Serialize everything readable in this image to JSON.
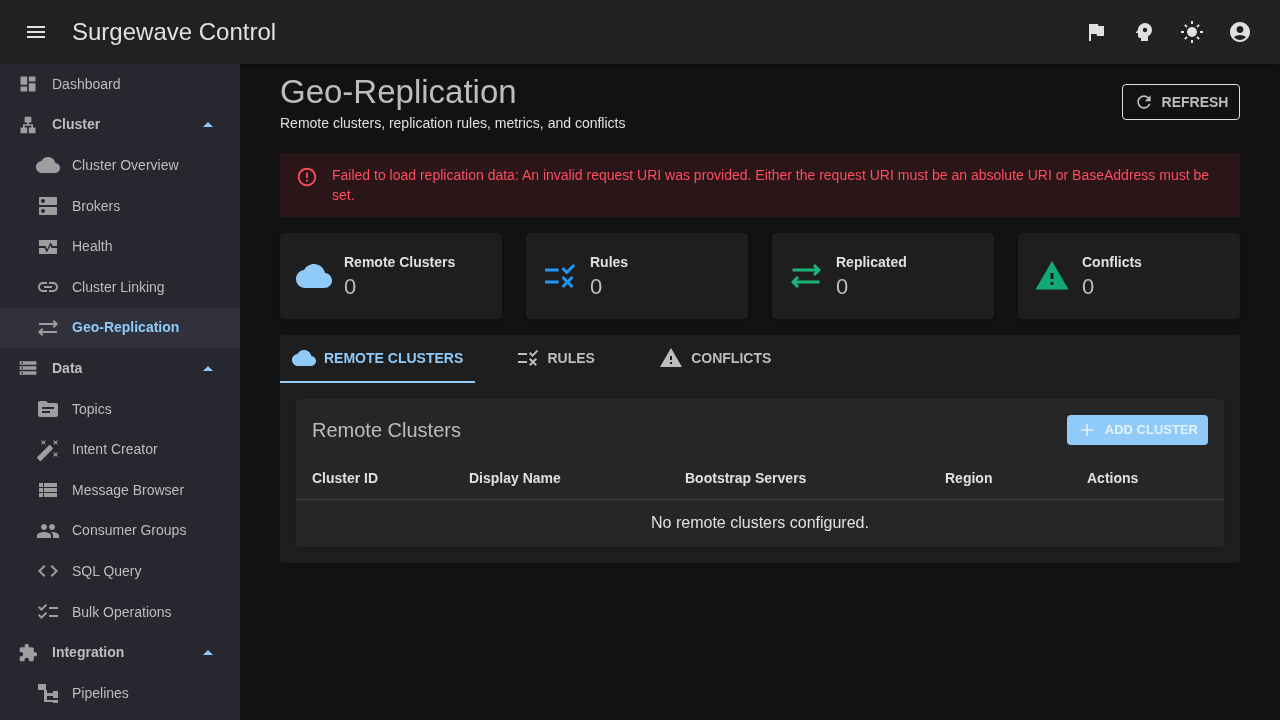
{
  "app_bar": {
    "title": "Surgewave Control"
  },
  "sidebar": {
    "items": [
      {
        "label": "Dashboard",
        "selected": false
      },
      {
        "label": "Cluster",
        "selected": false,
        "expanded": true,
        "children": [
          {
            "label": "Cluster Overview",
            "selected": false
          },
          {
            "label": "Brokers",
            "selected": false
          },
          {
            "label": "Health",
            "selected": false
          },
          {
            "label": "Cluster Linking",
            "selected": false
          },
          {
            "label": "Geo-Replication",
            "selected": true
          }
        ]
      },
      {
        "label": "Data",
        "selected": false,
        "expanded": true,
        "children": [
          {
            "label": "Topics",
            "selected": false
          },
          {
            "label": "Intent Creator",
            "selected": false
          },
          {
            "label": "Message Browser",
            "selected": false
          },
          {
            "label": "Consumer Groups",
            "selected": false
          },
          {
            "label": "SQL Query",
            "selected": false
          },
          {
            "label": "Bulk Operations",
            "selected": false
          }
        ]
      },
      {
        "label": "Integration",
        "selected": false,
        "expanded": true,
        "children": [
          {
            "label": "Pipelines",
            "selected": false
          }
        ]
      }
    ]
  },
  "page": {
    "title": "Geo-Replication",
    "subtitle": "Remote clusters, replication rules, metrics, and conflicts",
    "refresh_button": "REFRESH"
  },
  "error_alert": "Failed to load replication data: An invalid request URI was provided. Either the request URI must be an absolute URI or BaseAddress must be set.",
  "stats": [
    {
      "label": "Remote Clusters",
      "value": "0",
      "color": "#90caf9"
    },
    {
      "label": "Rules",
      "value": "0",
      "color": "#2196f3"
    },
    {
      "label": "Replicated",
      "value": "0",
      "color": "#1db47a"
    },
    {
      "label": "Conflicts",
      "value": "0",
      "color": "#12a878"
    }
  ],
  "tabs": [
    {
      "label": "REMOTE CLUSTERS",
      "selected": true
    },
    {
      "label": "RULES",
      "selected": false
    },
    {
      "label": "CONFLICTS",
      "selected": false
    }
  ],
  "remote_clusters": {
    "title": "Remote Clusters",
    "add_button": "ADD CLUSTER",
    "columns": [
      "Cluster ID",
      "Display Name",
      "Bootstrap Servers",
      "Region",
      "Actions"
    ],
    "empty_message": "No remote clusters configured."
  }
}
